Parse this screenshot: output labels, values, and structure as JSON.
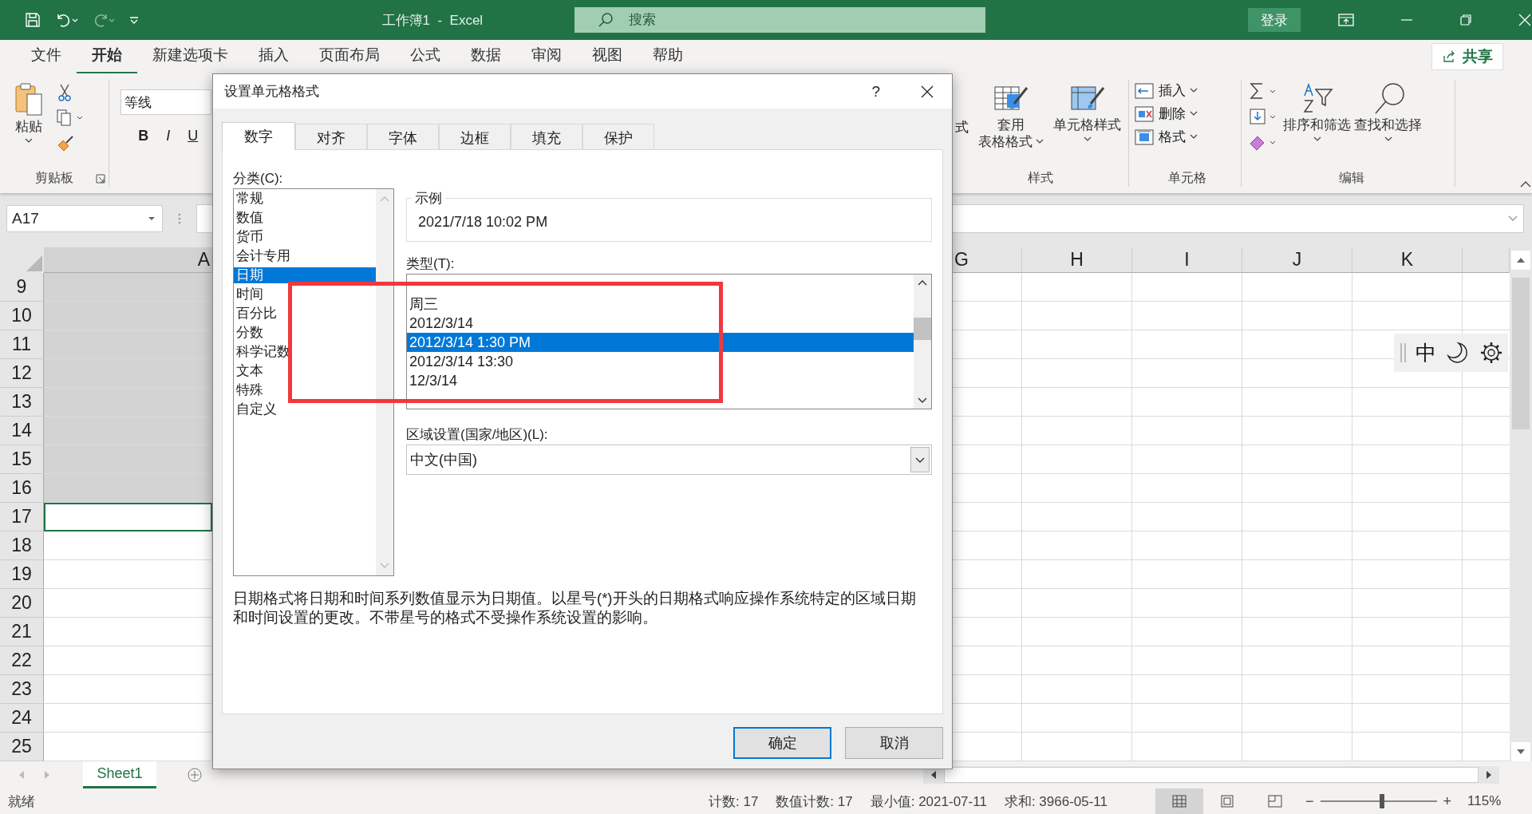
{
  "title_bar": {
    "title": "工作簿1  -  Excel",
    "search": {
      "placeholder": "搜索"
    },
    "sign_in": "登录"
  },
  "menu_tabs": [
    {
      "label": "文件",
      "selected": false
    },
    {
      "label": "开始",
      "selected": true
    },
    {
      "label": "新建选项卡",
      "selected": false
    },
    {
      "label": "插入",
      "selected": false
    },
    {
      "label": "页面布局",
      "selected": false
    },
    {
      "label": "公式",
      "selected": false
    },
    {
      "label": "数据",
      "selected": false
    },
    {
      "label": "审阅",
      "selected": false
    },
    {
      "label": "视图",
      "selected": false
    },
    {
      "label": "帮助",
      "selected": false
    }
  ],
  "share": "共享",
  "ribbon": {
    "clipboard": {
      "paste": "粘贴",
      "group": "剪贴板"
    },
    "font": {
      "name": "等线",
      "bold": "B",
      "italic": "I",
      "underline": "U"
    },
    "styles": {
      "fragment": "式",
      "table_format": [
        "套用",
        "表格格式"
      ],
      "cell_styles": "单元格样式",
      "group": "样式"
    },
    "cells": {
      "items": [
        "插入",
        "删除",
        "格式"
      ],
      "group": "单元格"
    },
    "editing": {
      "sort": "排序和筛选",
      "find": "查找和选择",
      "group": "编辑"
    }
  },
  "formula_bar": {
    "name_box": "A17"
  },
  "sheet": {
    "columns_left": [
      "A"
    ],
    "columns_right": [
      "G",
      "H",
      "I",
      "J",
      "K"
    ],
    "rows": [
      {
        "label": "9",
        "selected": true,
        "active": false
      },
      {
        "label": "10",
        "selected": true,
        "active": false
      },
      {
        "label": "11",
        "selected": true,
        "active": false
      },
      {
        "label": "12",
        "selected": true,
        "active": false
      },
      {
        "label": "13",
        "selected": true,
        "active": false
      },
      {
        "label": "14",
        "selected": true,
        "active": false
      },
      {
        "label": "15",
        "selected": true,
        "active": false
      },
      {
        "label": "16",
        "selected": true,
        "active": false
      },
      {
        "label": "17",
        "selected": false,
        "active": true
      },
      {
        "label": "18",
        "selected": false,
        "active": false
      },
      {
        "label": "19",
        "selected": false,
        "active": false
      },
      {
        "label": "20",
        "selected": false,
        "active": false
      },
      {
        "label": "21",
        "selected": false,
        "active": false
      },
      {
        "label": "22",
        "selected": false,
        "active": false
      },
      {
        "label": "23",
        "selected": false,
        "active": false
      },
      {
        "label": "24",
        "selected": false,
        "active": false
      },
      {
        "label": "25",
        "selected": false,
        "active": false
      }
    ]
  },
  "ime_toolbar": {
    "mode": "中"
  },
  "sheet_tabs": [
    {
      "label": "Sheet1",
      "selected": true
    }
  ],
  "status_bar": {
    "status": "就绪",
    "stats": [
      "计数: 17",
      "数值计数: 17",
      "最小值: 2021-07-11",
      "求和: 3966-05-11"
    ],
    "views": [
      {
        "kind": "normal",
        "selected": true
      },
      {
        "kind": "page_layout",
        "selected": false
      },
      {
        "kind": "page_break",
        "selected": false
      }
    ],
    "zoom": {
      "minus": "−",
      "plus": "+",
      "level": 0.53,
      "reading": "115%"
    }
  },
  "dialog": {
    "title": "设置单元格格式",
    "help": "?",
    "tabs": [
      {
        "label": "数字",
        "selected": true
      },
      {
        "label": "对齐",
        "selected": false
      },
      {
        "label": "字体",
        "selected": false
      },
      {
        "label": "边框",
        "selected": false
      },
      {
        "label": "填充",
        "selected": false
      },
      {
        "label": "保护",
        "selected": false
      }
    ],
    "category_label": "分类(C):",
    "categories": [
      {
        "label": "常规",
        "selected": false
      },
      {
        "label": "数值",
        "selected": false
      },
      {
        "label": "货币",
        "selected": false
      },
      {
        "label": "会计专用",
        "selected": false
      },
      {
        "label": "日期",
        "selected": true
      },
      {
        "label": "时间",
        "selected": false
      },
      {
        "label": "百分比",
        "selected": false
      },
      {
        "label": "分数",
        "selected": false
      },
      {
        "label": "科学记数",
        "selected": false
      },
      {
        "label": "文本",
        "selected": false
      },
      {
        "label": "特殊",
        "selected": false
      },
      {
        "label": "自定义",
        "selected": false
      }
    ],
    "sample": {
      "legend": "示例",
      "value": "2021/7/18 10:02 PM"
    },
    "type_label": "类型(T):",
    "types": [
      {
        "label": "周三",
        "selected": false
      },
      {
        "label": "2012/3/14",
        "selected": false
      },
      {
        "label": "2012/3/14 1:30 PM",
        "selected": true
      },
      {
        "label": "2012/3/14 13:30",
        "selected": false
      },
      {
        "label": "12/3/14",
        "selected": false
      }
    ],
    "locale_label": "区域设置(国家/地区)(L):",
    "locale": "中文(中国)",
    "description": "日期格式将日期和时间系列数值显示为日期值。以星号(*)开头的日期格式响应操作系统特定的区域日期和时间设置的更改。不带星号的格式不受操作系统设置的影响。",
    "buttons": [
      {
        "label": "确定",
        "kind": "default"
      },
      {
        "label": "取消",
        "kind": "normal"
      }
    ]
  },
  "annotation": {
    "kind": "rectangle"
  }
}
